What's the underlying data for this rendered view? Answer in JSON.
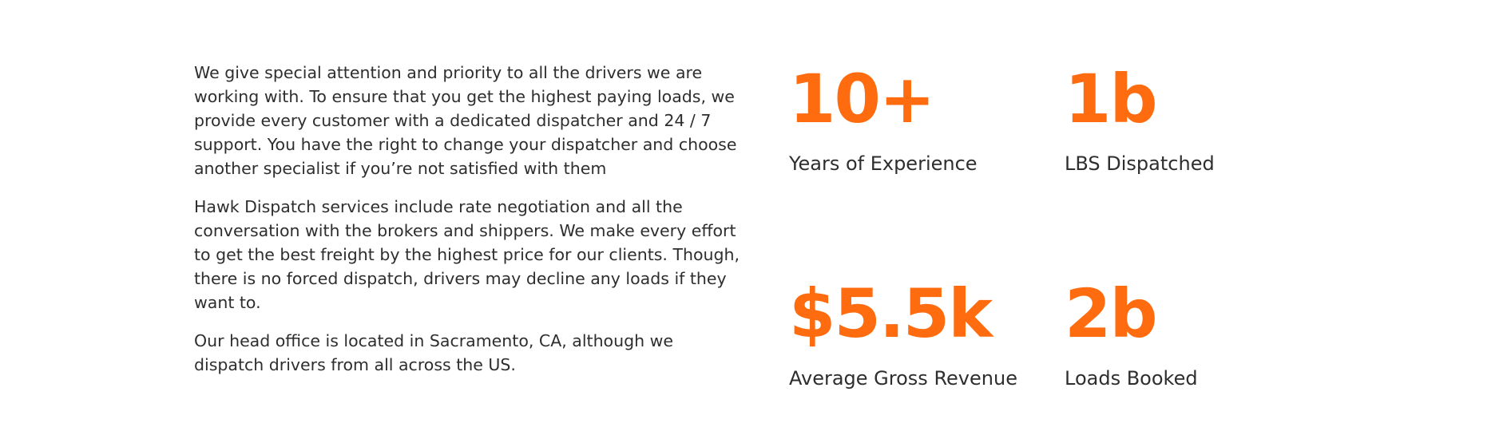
{
  "about": {
    "paragraphs": [
      "We give special attention and priority to all the drivers we are working with. To ensure that you get the highest paying loads, we provide every customer with a dedicated dispatcher and 24 / 7 support. You have the right to change your dispatcher and choose another specialist if you’re not satisfied with them",
      "Hawk Dispatch services include rate negotiation and all the conversation with the brokers and shippers. We make every effort to get the best freight by the highest price for our clients. Though, there is no forced dispatch, drivers may decline any loads if they want to.",
      "Our head office is located in Sacramento, CA, although we dispatch drivers from all across the US."
    ]
  },
  "stats": [
    {
      "value": "10+",
      "label": "Years of Experience"
    },
    {
      "value": "1b",
      "label": "LBS Dispatched"
    },
    {
      "value": "$5.5k",
      "label": "Average Gross Revenue"
    },
    {
      "value": "2b",
      "label": "Loads Booked"
    }
  ],
  "colors": {
    "accent": "#ff6b0f",
    "text": "#2e2e2e",
    "background": "#ffffff"
  }
}
